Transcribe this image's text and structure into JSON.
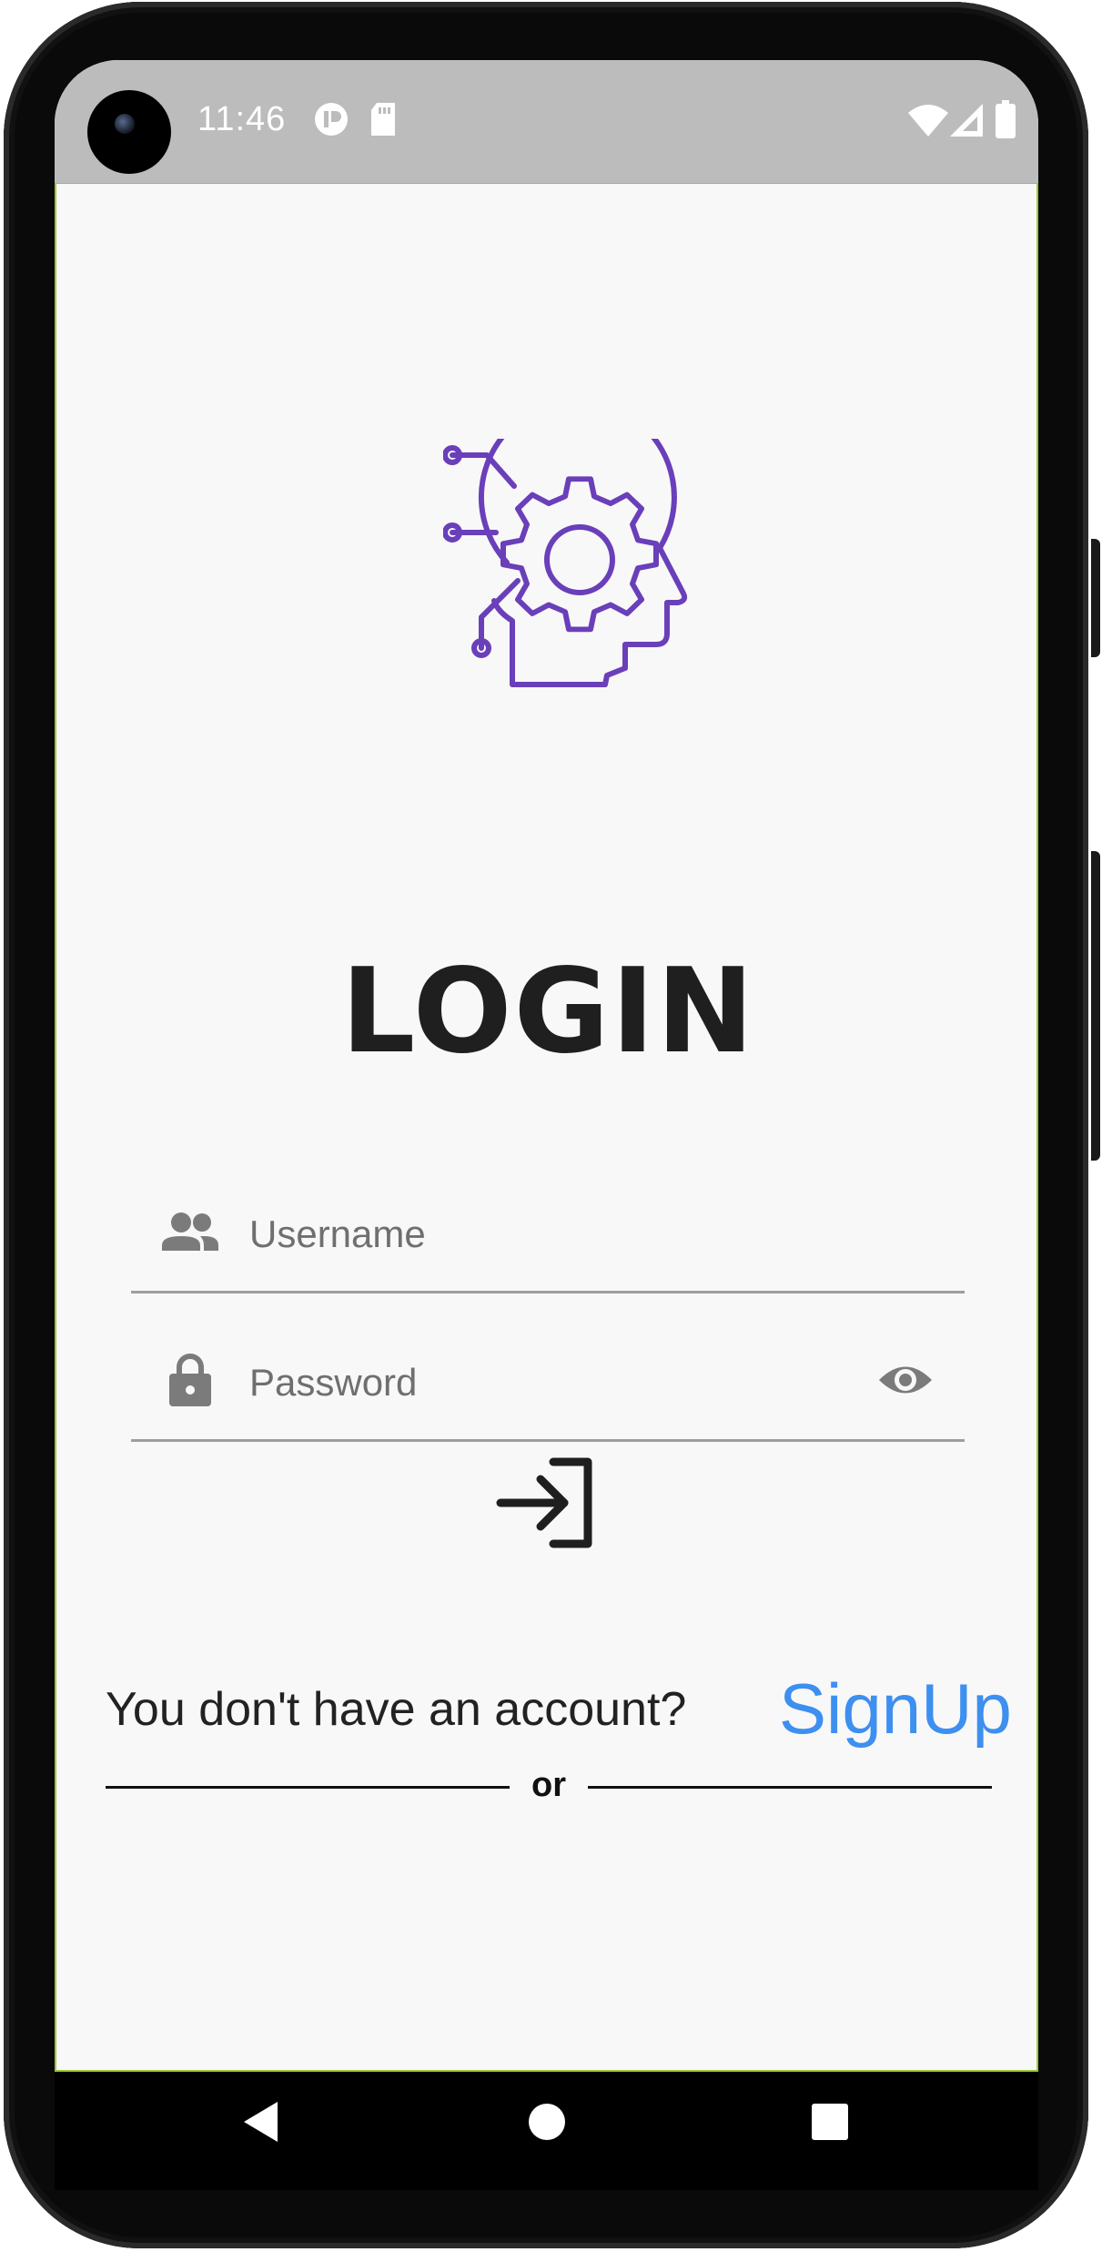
{
  "status_bar": {
    "time": "11:46",
    "icons": [
      "app-notification-icon",
      "sd-card-icon",
      "wifi-icon",
      "cellular-signal-icon",
      "battery-icon"
    ]
  },
  "login": {
    "title": "LOGIN",
    "logo_icon": "brain-gear-head-icon",
    "username_placeholder": "Username",
    "password_placeholder": "Password",
    "username_icon": "people-icon",
    "password_icon": "lock-icon",
    "visibility_icon": "eye-icon",
    "submit_icon": "login-arrow-icon"
  },
  "signup": {
    "prompt": "You don't have an account?",
    "link_label": "SignUp"
  },
  "divider": {
    "label": "or"
  },
  "nav_bar": {
    "buttons": [
      "back-icon",
      "home-icon",
      "recents-icon"
    ]
  },
  "colors": {
    "accent_purple": "#6a3fba",
    "link_blue": "#3d8ff0",
    "background": "#f8f8f8",
    "status_bar": "#bcbcbc"
  }
}
